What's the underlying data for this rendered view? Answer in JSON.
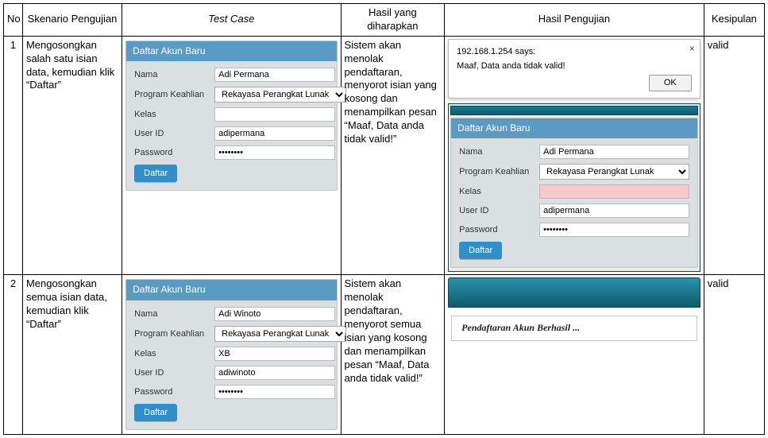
{
  "headers": {
    "no": "No",
    "skenario": "Skenario Pengujian",
    "testcase": "Test Case",
    "expected": "Hasil yang diharapkan",
    "result": "Hasil Pengujian",
    "conclusion": "Kesipulan"
  },
  "rows": [
    {
      "no": "1",
      "skenario": "Mengosongkan salah satu isian data, kemudian klik “Daftar”",
      "expected": "Sistem akan menolak pendaftaran, menyorot isian yang kosong dan menampilkan pesan “Maaf, Data anda tidak valid!”",
      "conclusion": "valid",
      "form_tc": {
        "title": "Daftar Akun Baru",
        "labels": {
          "nama": "Nama",
          "prog": "Program Keahlian",
          "kelas": "Kelas",
          "uid": "User ID",
          "pwd": "Password"
        },
        "values": {
          "nama": "Adi Permana",
          "prog": "Rekayasa Perangkat Lunak",
          "kelas": "",
          "uid": "adipermana",
          "pwd": "••••••••"
        },
        "button": "Daftar"
      },
      "dialog": {
        "origin": "192.168.1.254 says:",
        "message": "Maaf, Data anda tidak valid!",
        "ok": "OK"
      },
      "form_result": {
        "title": "Daftar Akun Baru",
        "labels": {
          "nama": "Nama",
          "prog": "Program Keahlian",
          "kelas": "Kelas",
          "uid": "User ID",
          "pwd": "Password"
        },
        "values": {
          "nama": "Adi Permana",
          "prog": "Rekayasa Perangkat Lunak",
          "kelas": "",
          "uid": "adipermana",
          "pwd": "••••••••"
        },
        "button": "Daftar"
      }
    },
    {
      "no": "2",
      "skenario": "Mengosongkan semua isian data, kemudian klik “Daftar”",
      "expected": "Sistem akan menolak pendaftaran, menyorot semua isian yang kosong dan menampilkan pesan “Maaf, Data anda tidak valid!”",
      "conclusion": "valid",
      "form_tc": {
        "title": "Daftar Akun Baru",
        "labels": {
          "nama": "Nama",
          "prog": "Program Keahlian",
          "kelas": "Kelas",
          "uid": "User ID",
          "pwd": "Password"
        },
        "values": {
          "nama": "Adi Winoto",
          "prog": "Rekayasa Perangkat Lunak",
          "kelas": "XB",
          "uid": "adiwinoto",
          "pwd": "••••••••"
        },
        "button": "Daftar"
      },
      "success_text": "Pendaftaran Akun Berhasil ..."
    }
  ]
}
